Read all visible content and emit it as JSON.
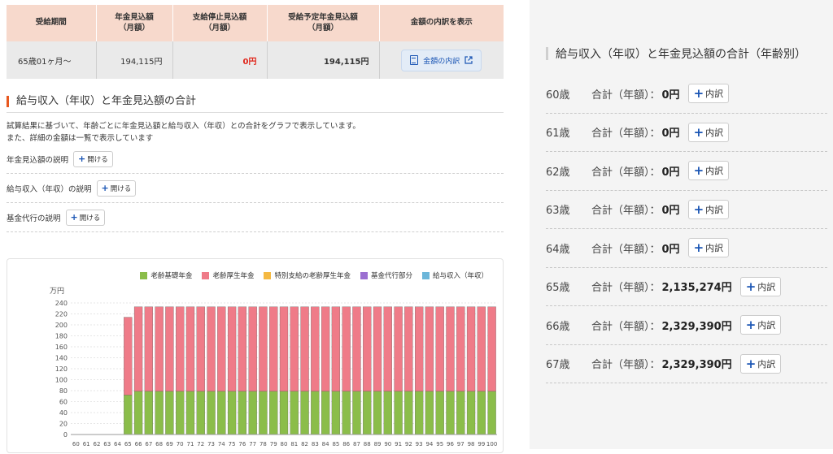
{
  "summary": {
    "headers": [
      "受給期間",
      "年金見込額\n（月額）",
      "支給停止見込額\n（月額）",
      "受給予定年金見込額\n（月額）",
      "金額の内訳を表示"
    ],
    "row": {
      "period": "65歳01ヶ月～",
      "pension": "194,115円",
      "stopped": "0円",
      "planned": "194,115円"
    },
    "detail_button": "金額の内訳"
  },
  "section": {
    "title": "給与収入（年収）と年金見込額の合計",
    "desc1": "試算結果に基づいて、年齢ごとに年金見込額と給与収入（年収）との合計をグラフで表示しています。",
    "desc2": "また、詳細の金額は一覧で表示しています",
    "expanders": [
      {
        "label": "年金見込額の説明",
        "button": "開ける"
      },
      {
        "label": "給与収入（年収）の説明",
        "button": "開ける"
      },
      {
        "label": "基金代行の説明",
        "button": "開ける"
      }
    ]
  },
  "chart_data": {
    "type": "bar",
    "stacked": true,
    "ylabel": "万円",
    "ylim": [
      0,
      240
    ],
    "yticks": [
      0,
      20,
      40,
      60,
      80,
      100,
      120,
      140,
      160,
      180,
      200,
      220,
      240
    ],
    "categories": [
      "60",
      "61",
      "62",
      "63",
      "64",
      "65",
      "66",
      "67",
      "68",
      "69",
      "70",
      "71",
      "72",
      "73",
      "74",
      "75",
      "76",
      "77",
      "78",
      "79",
      "80",
      "81",
      "82",
      "83",
      "84",
      "85",
      "86",
      "87",
      "88",
      "89",
      "90",
      "91",
      "92",
      "93",
      "94",
      "95",
      "96",
      "97",
      "98",
      "99",
      "100"
    ],
    "series": [
      {
        "name": "老齢基礎年金",
        "color": "#8bbd4a",
        "values": [
          0,
          0,
          0,
          0,
          0,
          72,
          79,
          79,
          79,
          79,
          79,
          79,
          79,
          79,
          79,
          79,
          79,
          79,
          79,
          79,
          79,
          79,
          79,
          79,
          79,
          79,
          79,
          79,
          79,
          79,
          79,
          79,
          79,
          79,
          79,
          79,
          79,
          79,
          79,
          79,
          79
        ]
      },
      {
        "name": "老齢厚生年金",
        "color": "#ef7b88",
        "values": [
          0,
          0,
          0,
          0,
          0,
          142,
          154,
          154,
          154,
          154,
          154,
          154,
          154,
          154,
          154,
          154,
          154,
          154,
          154,
          154,
          154,
          154,
          154,
          154,
          154,
          154,
          154,
          154,
          154,
          154,
          154,
          154,
          154,
          154,
          154,
          154,
          154,
          154,
          154,
          154,
          154
        ]
      },
      {
        "name": "特別支給の老齢厚生年金",
        "color": "#f5b942",
        "values": [
          0,
          0,
          0,
          0,
          0,
          0,
          0,
          0,
          0,
          0,
          0,
          0,
          0,
          0,
          0,
          0,
          0,
          0,
          0,
          0,
          0,
          0,
          0,
          0,
          0,
          0,
          0,
          0,
          0,
          0,
          0,
          0,
          0,
          0,
          0,
          0,
          0,
          0,
          0,
          0,
          0
        ]
      },
      {
        "name": "基金代行部分",
        "color": "#9b6fd1",
        "values": [
          0,
          0,
          0,
          0,
          0,
          0,
          0,
          0,
          0,
          0,
          0,
          0,
          0,
          0,
          0,
          0,
          0,
          0,
          0,
          0,
          0,
          0,
          0,
          0,
          0,
          0,
          0,
          0,
          0,
          0,
          0,
          0,
          0,
          0,
          0,
          0,
          0,
          0,
          0,
          0,
          0
        ]
      },
      {
        "name": "給与収入（年収）",
        "color": "#6cb6d9",
        "values": [
          0,
          0,
          0,
          0,
          0,
          0,
          0,
          0,
          0,
          0,
          0,
          0,
          0,
          0,
          0,
          0,
          0,
          0,
          0,
          0,
          0,
          0,
          0,
          0,
          0,
          0,
          0,
          0,
          0,
          0,
          0,
          0,
          0,
          0,
          0,
          0,
          0,
          0,
          0,
          0,
          0
        ]
      }
    ]
  },
  "right_panel": {
    "title": "給与収入（年収）と年金見込額の合計（年齢別）",
    "button_label": "内訳",
    "sum_label": "合計（年額）：",
    "rows": [
      {
        "age": "60歳",
        "value": "0円"
      },
      {
        "age": "61歳",
        "value": "0円"
      },
      {
        "age": "62歳",
        "value": "0円"
      },
      {
        "age": "63歳",
        "value": "0円"
      },
      {
        "age": "64歳",
        "value": "0円"
      },
      {
        "age": "65歳",
        "value": "2,135,274円"
      },
      {
        "age": "66歳",
        "value": "2,329,390円"
      },
      {
        "age": "67歳",
        "value": "2,329,390円"
      }
    ]
  }
}
